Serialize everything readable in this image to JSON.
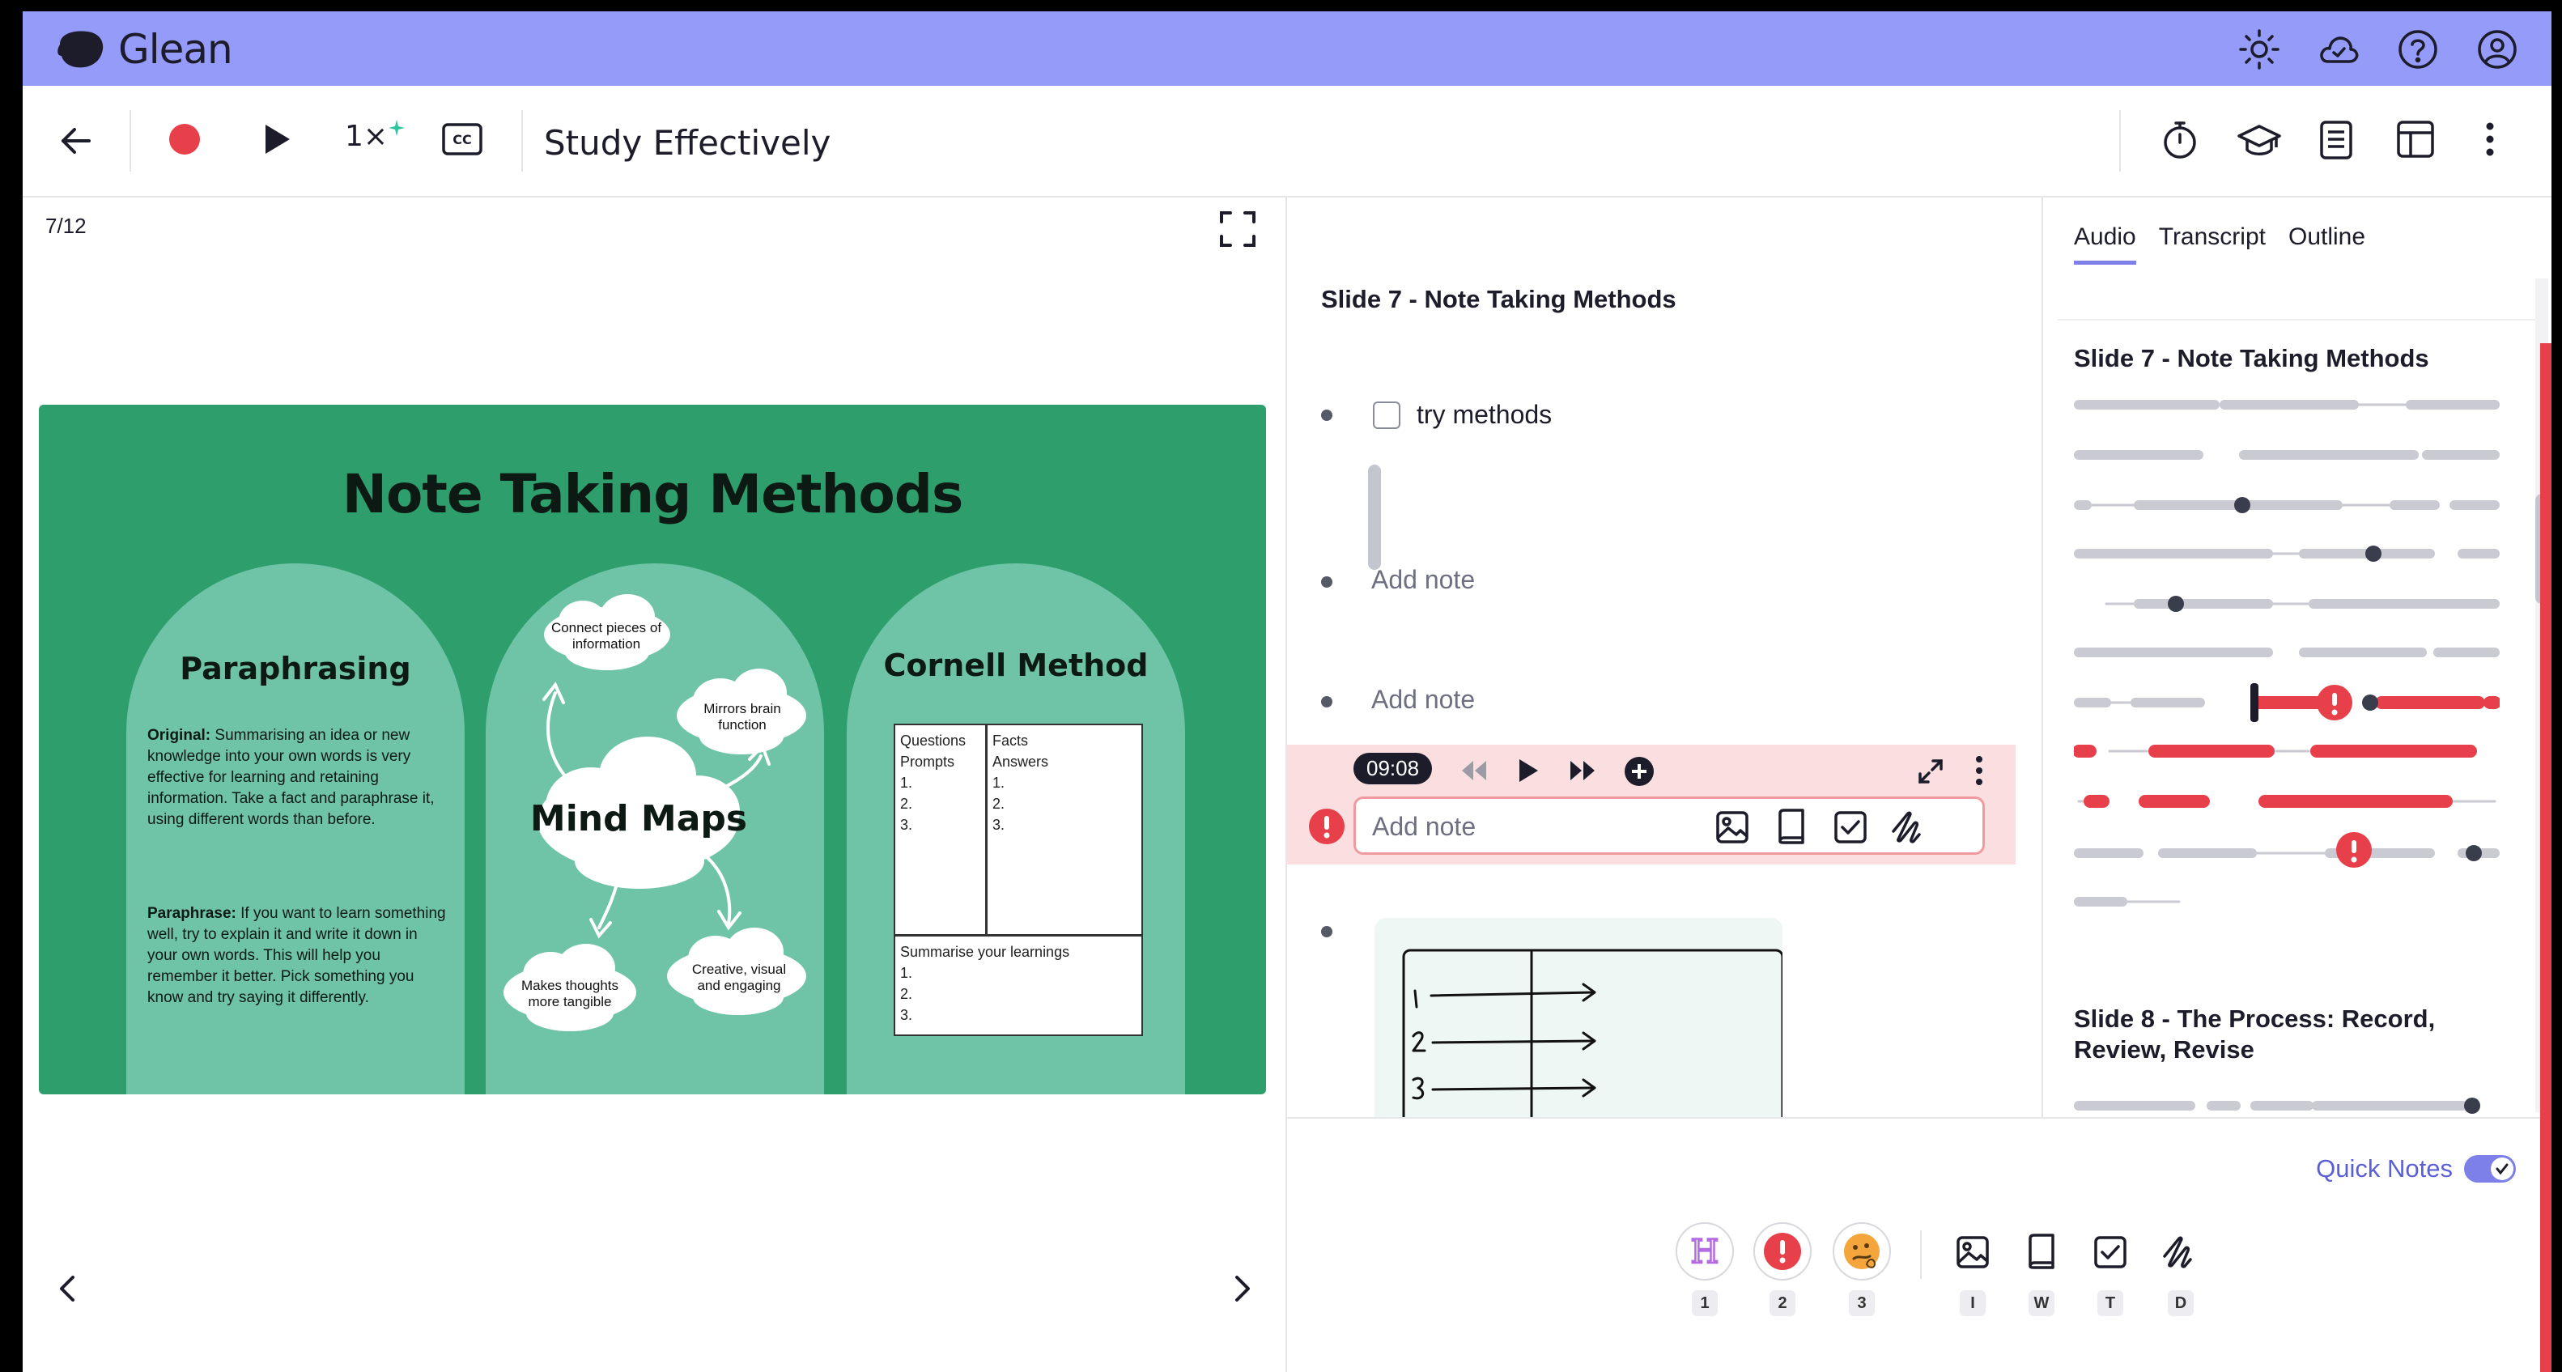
{
  "app": {
    "name": "Glean"
  },
  "top_icons": [
    "sun-icon",
    "cloud-sync-icon",
    "help-icon",
    "account-icon"
  ],
  "toolbar": {
    "speed": "1×",
    "title": "Study Effectively"
  },
  "slide_viewer": {
    "counter": "7/12",
    "slide": {
      "title": "Note Taking Methods",
      "paraphrasing": {
        "heading": "Paraphrasing",
        "original_label": "Original:",
        "original_text": " Summarising an idea or new knowledge into your own words is very effective for learning and retaining information. Take a fact and paraphrase it, using different words than before.",
        "paraphrase_label": "Paraphrase:",
        "paraphrase_text": " If you want to learn something well, try to explain it and write it down in your own words.  This will help you remember it better.  Pick something you know and try saying it differently."
      },
      "mind_maps": {
        "heading": "Mind Maps",
        "clouds": [
          "Connect pieces of information",
          "Mirrors brain function",
          "Makes thoughts more tangible",
          "Creative, visual and engaging"
        ]
      },
      "cornell": {
        "heading": "Cornell Method",
        "left_head_1": "Questions",
        "left_head_2": "Prompts",
        "right_head_1": "Facts",
        "right_head_2": "Answers",
        "n1": "1.",
        "n2": "2.",
        "n3": "3.",
        "summary": "Summarise your learnings"
      }
    }
  },
  "notes": {
    "section_title": "Slide 7 - Note Taking Methods",
    "items": [
      {
        "text": "try methods",
        "checked": false
      },
      {
        "placeholder": "Add note"
      },
      {
        "placeholder": "Add note"
      }
    ],
    "active": {
      "timestamp": "09:08",
      "placeholder": "Add note"
    }
  },
  "bottom": {
    "quick_notes_label": "Quick Notes",
    "quick_notes_on": true,
    "tools": [
      {
        "icon": "highlight-h-icon",
        "key": "1"
      },
      {
        "icon": "important-icon",
        "key": "2"
      },
      {
        "icon": "confused-face-icon",
        "key": "3"
      },
      {
        "icon": "image-icon",
        "key": "I"
      },
      {
        "icon": "book-icon",
        "key": "W"
      },
      {
        "icon": "checkbox-icon",
        "key": "T"
      },
      {
        "icon": "draw-icon",
        "key": "D"
      }
    ]
  },
  "right_panel": {
    "tabs": [
      "Audio",
      "Transcript",
      "Outline"
    ],
    "active_tab": "Audio",
    "section_1": "Slide 7 - Note Taking Methods",
    "section_2": "Slide 8 - The Process: Record, Review, Revise"
  },
  "colors": {
    "header": "#959bf9",
    "accent": "#7c80e8",
    "important": "#e8404a",
    "slide_green": "#2e9e6c",
    "arch_green": "#6fc4a8"
  }
}
